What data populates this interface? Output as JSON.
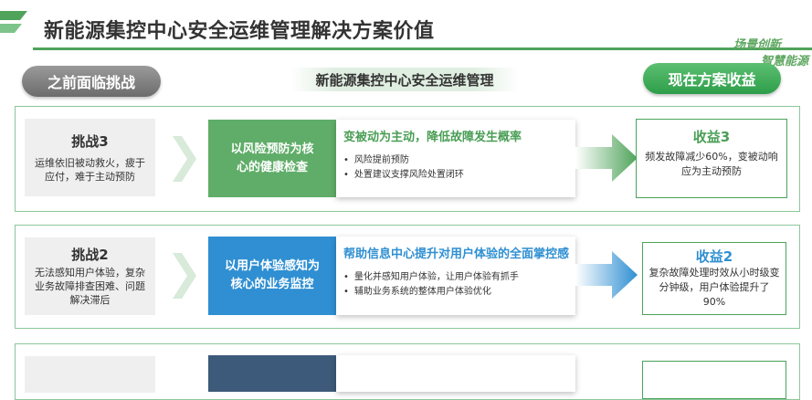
{
  "header": {
    "title": "新能源集控中心安全运维管理解决方案价值",
    "brand_line1": "场景创新",
    "brand_line2": "智慧能源"
  },
  "columns": {
    "left_label": "之前面临挑战",
    "middle_label": "新能源集控中心安全运维管理",
    "right_label": "现在方案收益"
  },
  "rows": [
    {
      "challenge_title": "挑战3",
      "challenge_desc": "运维依旧被动救火，疲于应付，难于主动预防",
      "solution": "以风险预防为核心的健康检查",
      "card_title": "变被动为主动，降低故障发生概率",
      "bullets": [
        "风险提前预防",
        "处置建议支撑风险处置闭环"
      ],
      "benefit_title": "收益3",
      "benefit_desc": "频发故障减少60%，变被动响应为主动预防"
    },
    {
      "challenge_title": "挑战2",
      "challenge_desc": "无法感知用户体验，复杂业务故障排查困难、问题解决滞后",
      "solution": "以用户体验感知为核心的业务监控",
      "card_title": "帮助信息中心提升对用户体验的全面掌控感",
      "bullets": [
        "量化并感知用户体验，让用户体验有抓手",
        "辅助业务系统的整体用户体验优化"
      ],
      "benefit_title": "收益2",
      "benefit_desc": "复杂故障处理时效从小时级变分钟级，用户体验提升了90%"
    }
  ],
  "colors": {
    "green": "#5fad68",
    "blue": "#2f8fd2",
    "navy": "#3d5a7a",
    "frame": "#8cc79a"
  }
}
